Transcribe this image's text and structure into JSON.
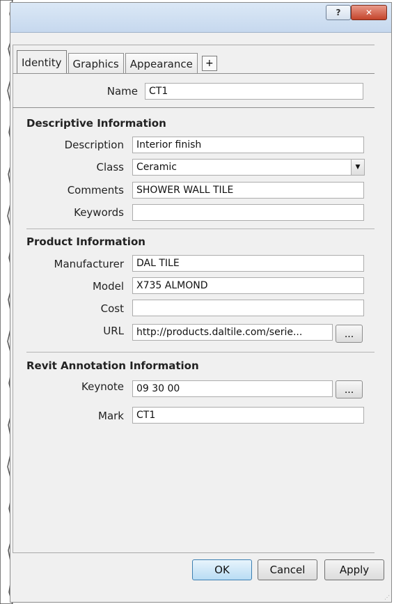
{
  "titlebar": {
    "help_icon": "question-mark-icon",
    "close_icon": "close-icon"
  },
  "tabs": [
    {
      "label": "Identity",
      "active": true
    },
    {
      "label": "Graphics",
      "active": false
    },
    {
      "label": "Appearance",
      "active": false
    }
  ],
  "add_tab_label": "+",
  "name_field": {
    "label": "Name",
    "value": "CT1"
  },
  "descriptive": {
    "title": "Descriptive Information",
    "description": {
      "label": "Description",
      "value": "Interior finish"
    },
    "class": {
      "label": "Class",
      "value": "Ceramic"
    },
    "comments": {
      "label": "Comments",
      "value": "SHOWER WALL TILE"
    },
    "keywords": {
      "label": "Keywords",
      "value": ""
    }
  },
  "product": {
    "title": "Product Information",
    "manufacturer": {
      "label": "Manufacturer",
      "value": "DAL TILE"
    },
    "model": {
      "label": "Model",
      "value": "X735 ALMOND"
    },
    "cost": {
      "label": "Cost",
      "value": ""
    },
    "url": {
      "label": "URL",
      "value": "http://products.daltile.com/serie..."
    }
  },
  "revit": {
    "title": "Revit Annotation Information",
    "keynote": {
      "label": "Keynote",
      "value": "09 30 00"
    },
    "mark": {
      "label": "Mark",
      "value": "CT1"
    }
  },
  "browse_label": "...",
  "buttons": {
    "ok": "OK",
    "cancel": "Cancel",
    "apply": "Apply"
  },
  "colors": {
    "titlebar": "#c6d8ee",
    "close": "#c4442b",
    "panel": "#f0f0f0"
  }
}
